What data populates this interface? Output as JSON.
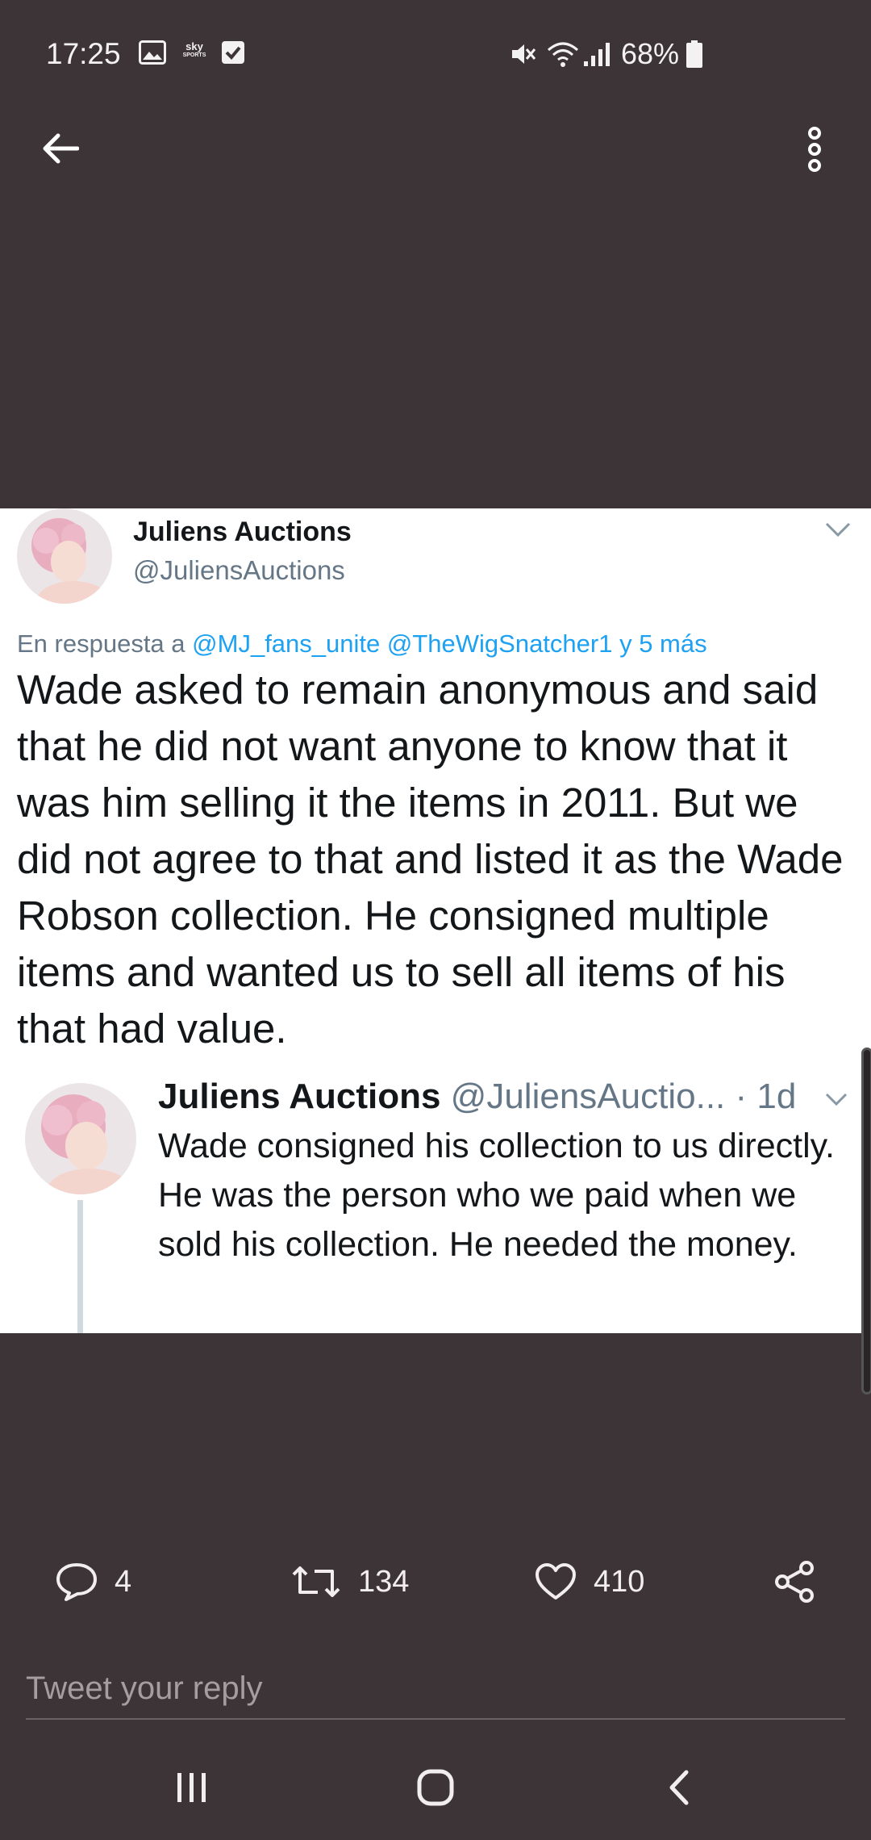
{
  "status_bar": {
    "time": "17:25",
    "sky_label_top": "sky",
    "sky_label_bottom": "SPORTS",
    "battery": "68%",
    "icons": [
      "gallery-icon",
      "sky-sports-icon",
      "checkbox-icon",
      "mute-icon",
      "wifi-icon",
      "signal-icon",
      "battery-icon"
    ]
  },
  "app_bar": {
    "icons": [
      "back-arrow-icon",
      "more-vertical-icon"
    ]
  },
  "tweet": {
    "author_name": "Juliens Auctions",
    "author_handle": "@JuliensAuctions",
    "reply_prefix": "En respuesta a",
    "reply_mention_1": "@MJ_fans_unite",
    "reply_mention_2": "@TheWigSnatcher1",
    "reply_suffix": "y 5 más",
    "text": "Wade asked to remain anonymous and said that he did not want anyone to know that it was him selling it the items in 2011. But we did not agree to that and listed it as the Wade Robson collection. He consigned multiple items and wanted us to sell all items of his that had value.",
    "quoted": {
      "author_name": "Juliens Auctions",
      "author_handle": "@JuliensAuctio...",
      "time": "· 1d",
      "text": "Wade consigned his collection to us directly. He was the person who we paid when we sold his collection. He needed the money."
    }
  },
  "actions": {
    "replies": "4",
    "retweets": "134",
    "likes": "410",
    "icons": [
      "reply-icon",
      "retweet-icon",
      "heart-icon",
      "share-icon"
    ]
  },
  "reply_box": {
    "placeholder": "Tweet your reply"
  },
  "nav_bar": {
    "icons": [
      "recent-apps-icon",
      "home-icon",
      "back-icon"
    ]
  },
  "colors": {
    "background": "#3d3437",
    "card": "#ffffff",
    "link": "#1da1f2",
    "secondary_text": "#657786"
  }
}
